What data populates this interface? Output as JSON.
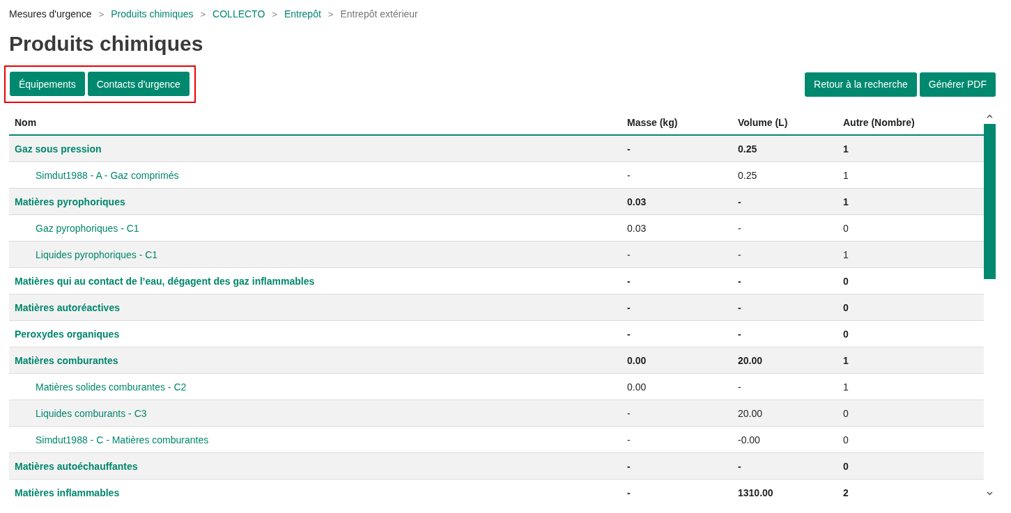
{
  "breadcrumb": [
    {
      "label": "Mesures d'urgence",
      "kind": "root"
    },
    {
      "label": "Produits chimiques",
      "kind": "link"
    },
    {
      "label": "COLLECTO",
      "kind": "link"
    },
    {
      "label": "Entrepôt",
      "kind": "link"
    },
    {
      "label": "Entrepôt extérieur",
      "kind": "current"
    }
  ],
  "separator": ">",
  "title": "Produits chimiques",
  "left_buttons": [
    "Équipements",
    "Contacts d'urgence"
  ],
  "right_buttons": [
    "Retour à la recherche",
    "Générer PDF"
  ],
  "table": {
    "columns": [
      "Nom",
      "Masse (kg)",
      "Volume (L)",
      "Autre (Nombre)"
    ],
    "rows": [
      {
        "kind": "group",
        "cells": [
          "Gaz sous pression",
          "-",
          "0.25",
          "1"
        ]
      },
      {
        "kind": "item",
        "cells": [
          "Simdut1988 - A - Gaz comprimés",
          "-",
          "0.25",
          "1"
        ]
      },
      {
        "kind": "group",
        "cells": [
          "Matières pyrophoriques",
          "0.03",
          "-",
          "1"
        ]
      },
      {
        "kind": "item",
        "cells": [
          "Gaz pyrophoriques - C1",
          "0.03",
          "-",
          "0"
        ]
      },
      {
        "kind": "item",
        "cells": [
          "Liquides pyrophoriques - C1",
          "-",
          "-",
          "1"
        ]
      },
      {
        "kind": "group",
        "cells": [
          "Matières qui au contact de l’eau, dégagent des gaz inflammables",
          "-",
          "-",
          "0"
        ]
      },
      {
        "kind": "group",
        "cells": [
          "Matières autoréactives",
          "-",
          "-",
          "0"
        ]
      },
      {
        "kind": "group",
        "cells": [
          "Peroxydes organiques",
          "-",
          "-",
          "0"
        ]
      },
      {
        "kind": "group",
        "cells": [
          "Matières comburantes",
          "0.00",
          "20.00",
          "1"
        ]
      },
      {
        "kind": "item",
        "cells": [
          "Matières solides comburantes - C2",
          "0.00",
          "-",
          "1"
        ]
      },
      {
        "kind": "item",
        "cells": [
          "Liquides comburants - C3",
          "-",
          "20.00",
          "0"
        ]
      },
      {
        "kind": "item",
        "cells": [
          "Simdut1988 - C - Matières comburantes",
          "-",
          "-0.00",
          "0"
        ]
      },
      {
        "kind": "group",
        "cells": [
          "Matières autoéchauffantes",
          "-",
          "-",
          "0"
        ]
      },
      {
        "kind": "group",
        "cells": [
          "Matières inflammables",
          "-",
          "1310.00",
          "2"
        ]
      }
    ]
  }
}
